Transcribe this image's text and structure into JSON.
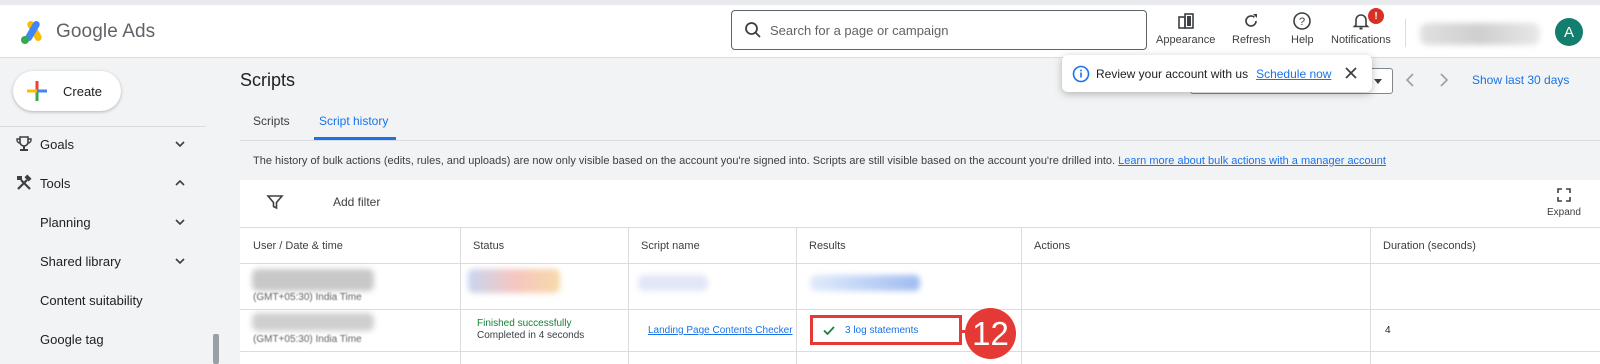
{
  "app": {
    "name": "Google Ads"
  },
  "search": {
    "placeholder": "Search for a page or campaign"
  },
  "header_tools": [
    {
      "label": "Appearance",
      "icon": "appearance-icon"
    },
    {
      "label": "Refresh",
      "icon": "refresh-icon"
    },
    {
      "label": "Help",
      "icon": "help-icon"
    },
    {
      "label": "Notifications",
      "icon": "bell-icon",
      "badge": "!"
    }
  ],
  "user": {
    "avatar_letter": "A"
  },
  "sidebar": {
    "create_label": "Create",
    "items": [
      {
        "label": "Goals",
        "icon": "trophy-icon",
        "chevron": "down"
      },
      {
        "label": "Tools",
        "icon": "tools-icon",
        "chevron": "up"
      },
      {
        "label": "Planning",
        "chevron": "down"
      },
      {
        "label": "Shared library",
        "chevron": "down"
      },
      {
        "label": "Content suitability"
      },
      {
        "label": "Google tag"
      }
    ]
  },
  "page": {
    "title": "Scripts",
    "tabs": [
      {
        "label": "Scripts",
        "active": false
      },
      {
        "label": "Script history",
        "active": true
      }
    ],
    "info_text": "The history of bulk actions (edits, rules, and uploads) are now only visible based on the account you're signed into. Scripts are still visible based on the account you're drilled into.",
    "info_link": "Learn more about bulk actions with a manager account",
    "show_last": "Show last 30 days"
  },
  "toast": {
    "text": "Review your account with us",
    "link": "Schedule now"
  },
  "table": {
    "add_filter": "Add filter",
    "expand_label": "Expand",
    "columns": [
      "User / Date & time",
      "Status",
      "Script name",
      "Results",
      "Actions",
      "Duration (seconds)"
    ],
    "rows": [
      {
        "timezone": "(GMT+05:30) India Time"
      },
      {
        "timezone": "(GMT+05:30) India Time",
        "status_line1": "Finished successfully",
        "status_line2": "Completed in 4 seconds",
        "script_name": "Landing Page Contents Checker",
        "results": "3 log statements",
        "duration": "4"
      }
    ]
  },
  "annotation": {
    "step_number": "12",
    "color": "#e53935"
  },
  "colors": {
    "accent": "#1a73e8",
    "success": "#188038",
    "badge": "#d93025"
  }
}
